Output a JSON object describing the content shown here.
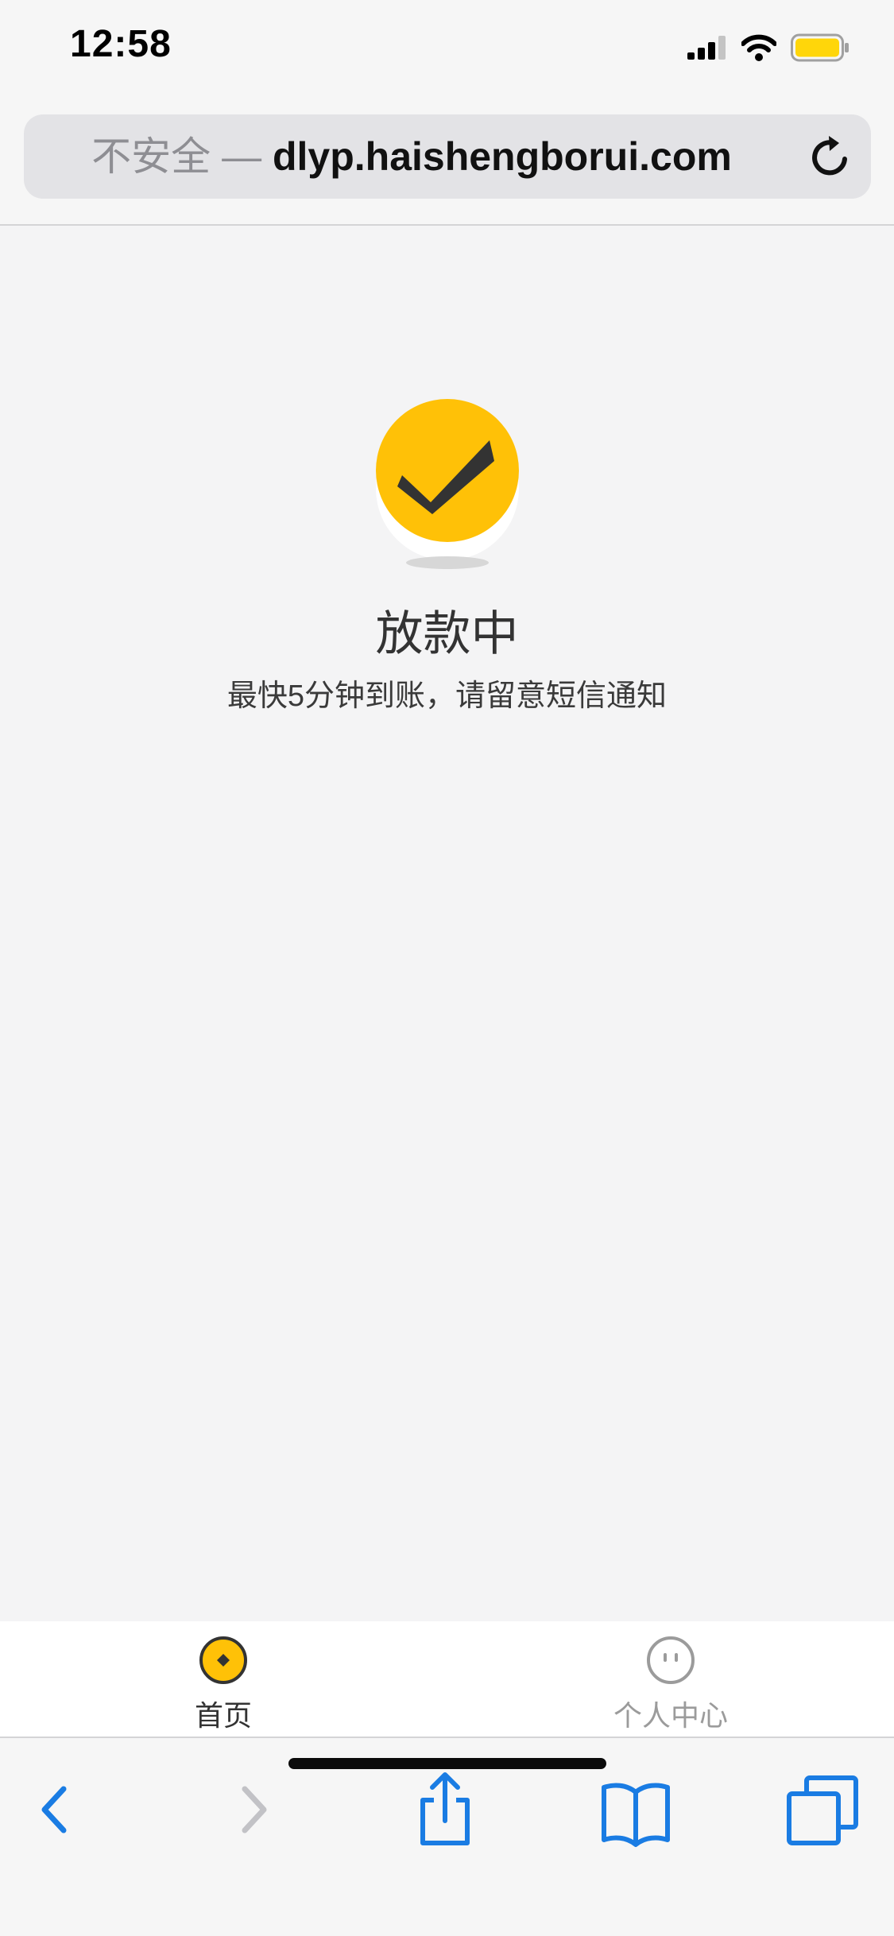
{
  "status_bar": {
    "time": "12:58",
    "battery_color": "#ffd60a"
  },
  "address_bar": {
    "security_label": "不安全 —",
    "domain": "dlyp.haishengborui.com"
  },
  "main": {
    "title": "放款中",
    "subtitle": "最快5分钟到账，请留意短信通知",
    "accent_color": "#ffc107"
  },
  "app_tabs": [
    {
      "label": "首页",
      "icon": "coin-icon",
      "active": true
    },
    {
      "label": "个人中心",
      "icon": "face-icon",
      "active": false
    }
  ],
  "safari_toolbar": {
    "icons": [
      "back-icon",
      "forward-icon",
      "share-icon",
      "bookmarks-icon",
      "tabs-icon"
    ],
    "tint_color": "#1a7ce3"
  }
}
